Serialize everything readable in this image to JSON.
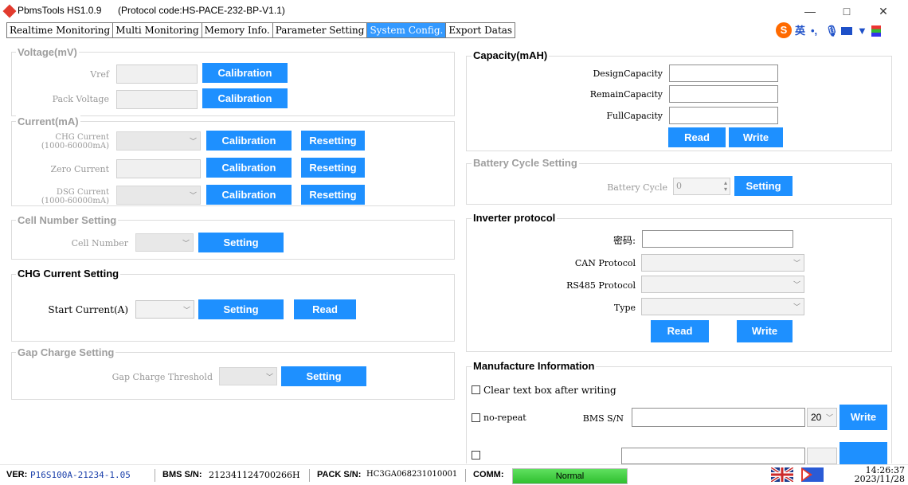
{
  "window": {
    "title": "PbmsTools HS1.0.9",
    "protocol": "(Protocol code:HS-PACE-232-BP-V1.1)",
    "controls": {
      "minimize": "—",
      "maximize": "□",
      "close": "✕"
    }
  },
  "tabs": [
    {
      "label": "Realtime Monitoring",
      "active": false
    },
    {
      "label": "Multi Monitoring",
      "active": false
    },
    {
      "label": "Memory Info.",
      "active": false
    },
    {
      "label": "Parameter Setting",
      "active": false
    },
    {
      "label": "System Config.",
      "active": true
    },
    {
      "label": "Export Datas",
      "active": false
    }
  ],
  "tray": {
    "ime_logo": "S",
    "ime_lang": "英"
  },
  "voltage": {
    "title": "Voltage(mV)",
    "vref_label": "Vref",
    "pack_label": "Pack Voltage",
    "calibration": "Calibration"
  },
  "current": {
    "title": "Current(mA)",
    "chg_label": "CHG Current",
    "chg_range": "(1000-60000mA)",
    "zero_label": "Zero Current",
    "dsg_label": "DSG Current",
    "dsg_range": "(1000-60000mA)",
    "calibration": "Calibration",
    "resetting": "Resetting"
  },
  "cell_number": {
    "title": "Cell Number Setting",
    "label": "Cell Number",
    "button": "Setting"
  },
  "chg_current": {
    "title": "CHG Current Setting",
    "label": "Start Current(A)",
    "setting": "Setting",
    "read": "Read"
  },
  "gap_charge": {
    "title": "Gap Charge Setting",
    "label": "Gap Charge Threshold",
    "button": "Setting"
  },
  "capacity": {
    "title": "Capacity(mAH)",
    "design": "DesignCapacity",
    "remain": "RemainCapacity",
    "full": "FullCapacity",
    "read": "Read",
    "write": "Write"
  },
  "battery_cycle": {
    "title": "Battery Cycle Setting",
    "label": "Battery Cycle",
    "value": "0",
    "button": "Setting"
  },
  "inverter": {
    "title": "Inverter protocol",
    "password": "密码:",
    "can": "CAN Protocol",
    "rs485": "RS485 Protocol",
    "type": "Type",
    "read": "Read",
    "write": "Write"
  },
  "manufacture": {
    "title": "Manufacture Information",
    "clear_text": "Clear text box after writing",
    "no_repeat": "no-repeat",
    "bms_sn_label": "BMS S/N",
    "bms_len": "20",
    "write": "Write"
  },
  "status": {
    "ver_label": "VER:",
    "ver": "P16S100A-21234-1.05",
    "bms_label": "BMS S/N:",
    "bms": "212341124700266H",
    "pack_label": "PACK S/N:",
    "pack": "HC3GA068231010001",
    "comm_label": "COMM:",
    "comm": "Normal",
    "time": "14:26:37",
    "date": "2023/11/28"
  },
  "colors": {
    "accent": "#1e90ff",
    "active_tab": "#3399ff",
    "comm_ok": "#33cc33"
  }
}
